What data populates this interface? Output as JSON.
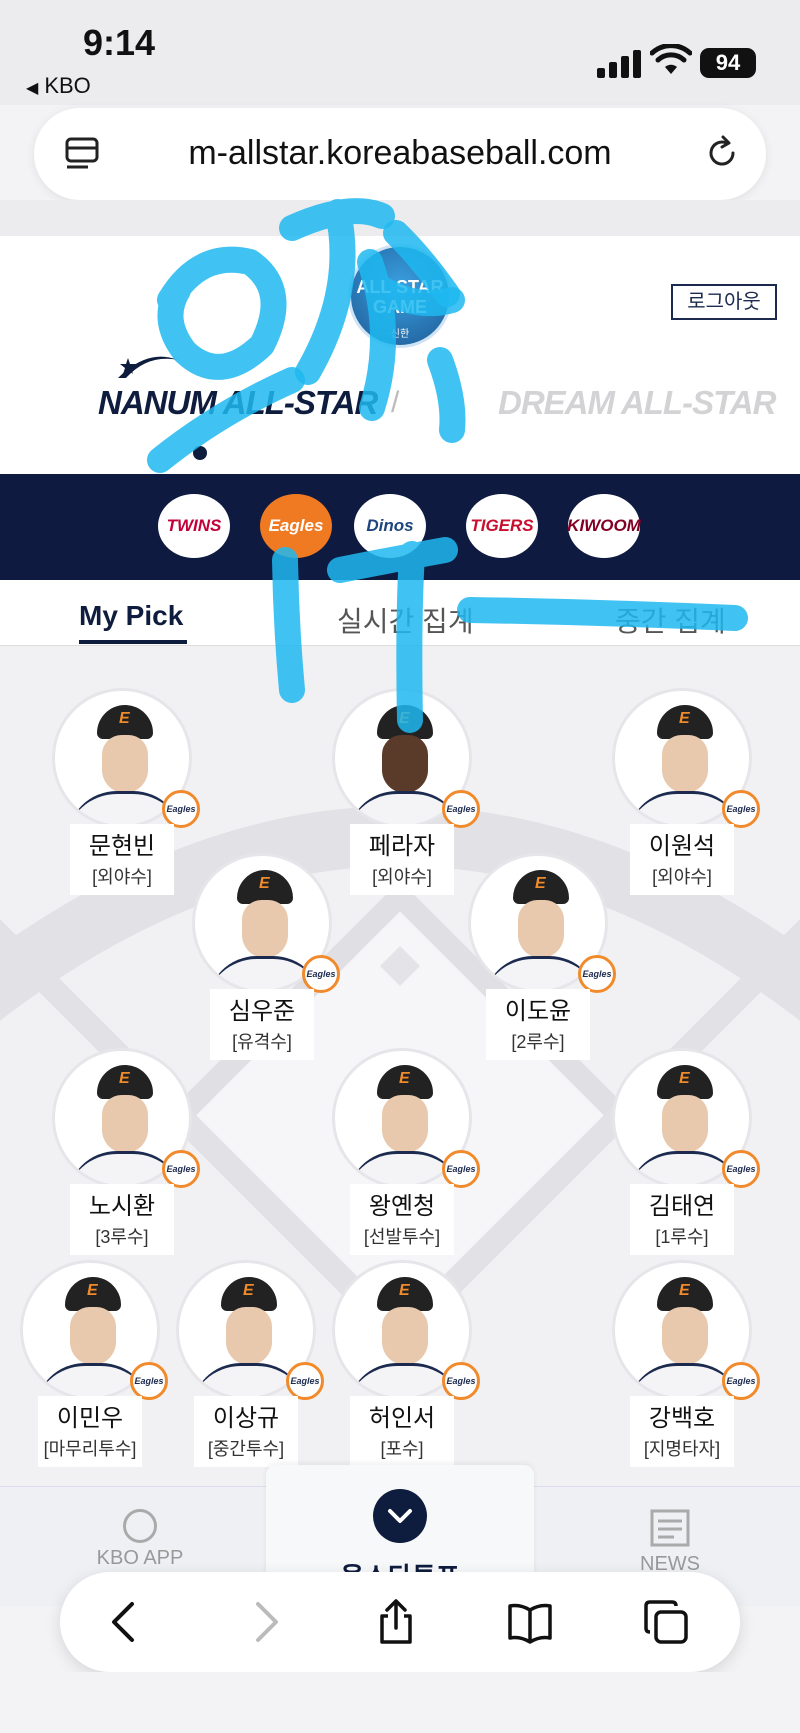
{
  "status_bar": {
    "time": "9:14",
    "back_app": "KBO",
    "battery": "94"
  },
  "browser": {
    "url": "m-allstar.koreabaseball.com"
  },
  "header": {
    "logo_line1": "ALL STAR",
    "logo_line2": "GAME",
    "logo_sponsor": "신한",
    "logout_label": "로그아웃",
    "team_left": "NANUM ALL-STAR",
    "team_right": "DREAM ALL-STAR"
  },
  "team_logos": [
    {
      "name": "TWINS",
      "bg": "#ffffff",
      "fg": "#c30037"
    },
    {
      "name": "Eagles",
      "bg": "#f07a22",
      "fg": "#ffffff"
    },
    {
      "name": "Dinos",
      "bg": "#ffffff",
      "fg": "#1d467e"
    },
    {
      "name": "TIGERS",
      "bg": "#ffffff",
      "fg": "#c8102e"
    },
    {
      "name": "KIWOOM",
      "bg": "#ffffff",
      "fg": "#820024"
    }
  ],
  "tabs": [
    {
      "label": "My Pick",
      "active": true
    },
    {
      "label": "실시간 집계",
      "active": false
    },
    {
      "label": "중간 집계",
      "active": false
    }
  ],
  "players": [
    {
      "name": "문현빈",
      "pos": "[외야수]",
      "dark": false
    },
    {
      "name": "페라자",
      "pos": "[외야수]",
      "dark": true
    },
    {
      "name": "이원석",
      "pos": "[외야수]",
      "dark": false
    },
    {
      "name": "심우준",
      "pos": "[유격수]",
      "dark": false
    },
    {
      "name": "이도윤",
      "pos": "[2루수]",
      "dark": false
    },
    {
      "name": "노시환",
      "pos": "[3루수]",
      "dark": false
    },
    {
      "name": "왕옌청",
      "pos": "[선발투수]",
      "dark": false
    },
    {
      "name": "김태연",
      "pos": "[1루수]",
      "dark": false
    },
    {
      "name": "이민우",
      "pos": "[마무리투수]",
      "dark": false
    },
    {
      "name": "이상규",
      "pos": "[중간투수]",
      "dark": false
    },
    {
      "name": "허인서",
      "pos": "[포수]",
      "dark": false
    },
    {
      "name": "강백호",
      "pos": "[지명타자]",
      "dark": false
    }
  ],
  "team_badge_text": "Eagles",
  "bottom_nav": {
    "left": "KBO APP",
    "center": "올스타투표",
    "right": "NEWS"
  },
  "colors": {
    "navy": "#0e1c3d",
    "eagles_orange": "#f08a2b",
    "scribble": "#1fb8f0"
  }
}
